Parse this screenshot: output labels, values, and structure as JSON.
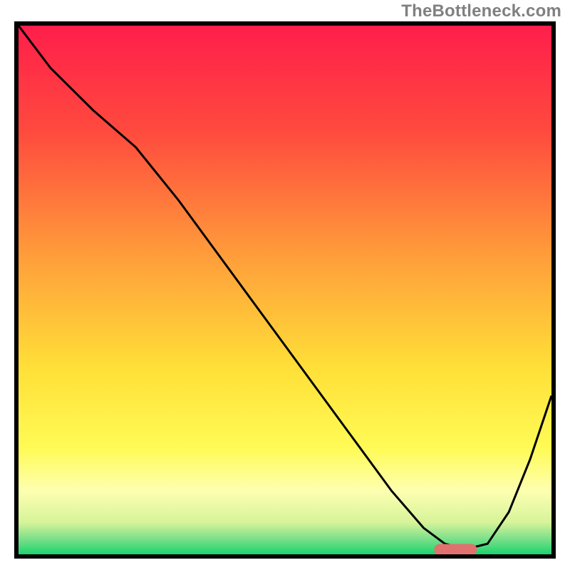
{
  "watermark": "TheBottleneck.com",
  "chart_data": {
    "type": "line",
    "title": "",
    "xlabel": "",
    "ylabel": "",
    "xlim": [
      0,
      100
    ],
    "ylim": [
      0,
      100
    ],
    "gradient_stops": [
      {
        "offset": 0,
        "color": "#ff1e4b"
      },
      {
        "offset": 20,
        "color": "#ff4a3e"
      },
      {
        "offset": 45,
        "color": "#ffa23a"
      },
      {
        "offset": 65,
        "color": "#ffe038"
      },
      {
        "offset": 80,
        "color": "#fffb56"
      },
      {
        "offset": 88,
        "color": "#fdffb0"
      },
      {
        "offset": 94,
        "color": "#d6f39a"
      },
      {
        "offset": 97,
        "color": "#7ee08a"
      },
      {
        "offset": 100,
        "color": "#1bd36f"
      }
    ],
    "series": [
      {
        "name": "bottleneck-curve",
        "color": "#000000",
        "x": [
          0,
          6,
          14,
          22,
          30,
          38,
          46,
          54,
          62,
          70,
          76,
          80,
          84,
          88,
          92,
          96,
          100
        ],
        "y": [
          100,
          92,
          84,
          77,
          67,
          56,
          45,
          34,
          23,
          12,
          5,
          2,
          1,
          2,
          8,
          18,
          30
        ]
      }
    ],
    "marker": {
      "name": "optimal-range-marker",
      "color": "#e0716f",
      "x_start": 78,
      "x_end": 86,
      "y": 0.9,
      "thickness": 2.1
    }
  }
}
